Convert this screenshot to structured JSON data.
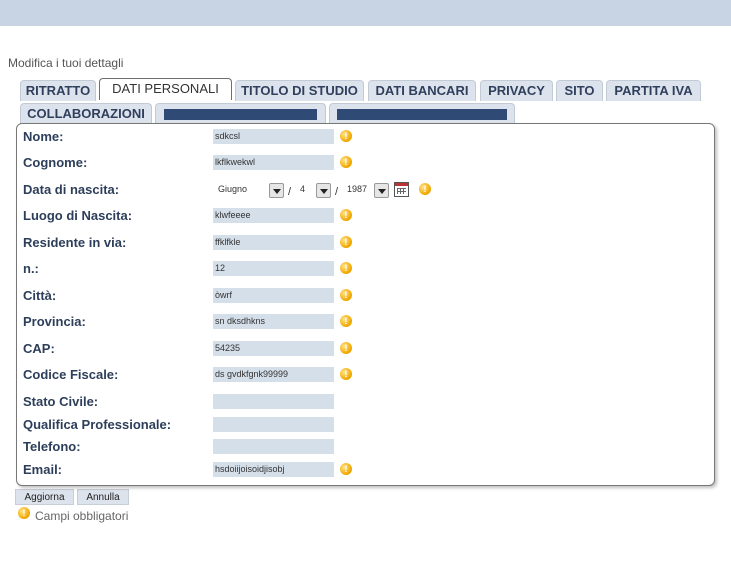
{
  "page_heading": "Modifica i tuoi dettagli",
  "tabs": {
    "ritratto": "RITRATTO",
    "dati_personali": "DATI PERSONALI",
    "titolo_di_studio": "TITOLO DI STUDIO",
    "dati_bancari": "DATI BANCARI",
    "privacy": "PRIVACY",
    "sito": "SITO",
    "partita_iva": "PARTITA IVA",
    "collaborazioni": "COLLABORAZIONI"
  },
  "form": {
    "nome": {
      "label": "Nome:",
      "value": "sdkcsl"
    },
    "cognome": {
      "label": "Cognome:",
      "value": "lkflkwekwl"
    },
    "data_nascita": {
      "label": "Data di nascita:",
      "month": "Giugno",
      "day": "4",
      "year": "1987",
      "separator": "/"
    },
    "luogo_nascita": {
      "label": "Luogo di Nascita:",
      "value": "klwfeeee"
    },
    "residente": {
      "label": "Residente in via:",
      "value": "ffklfkle"
    },
    "numero": {
      "label": "n.:",
      "value": "12"
    },
    "citta": {
      "label": "Città:",
      "value": "òwrf"
    },
    "provincia": {
      "label": "Provincia:",
      "value": "sn dksdhkns"
    },
    "cap": {
      "label": "CAP:",
      "value": "54235"
    },
    "codice_fiscale": {
      "label": "Codice Fiscale:",
      "value": "ds gvdkfgnk99999"
    },
    "stato_civile": {
      "label": "Stato Civile:",
      "value": ""
    },
    "qualifica": {
      "label": "Qualifica Professionale:",
      "value": ""
    },
    "telefono": {
      "label": "Telefono:",
      "value": ""
    },
    "email": {
      "label": "Email:",
      "value": "hsdoiijoisoidjisobj"
    }
  },
  "required_icon": "!",
  "buttons": {
    "aggiorna": "Aggiorna",
    "annulla": "Annulla"
  },
  "legend": {
    "required_text": "Campi obbligatori"
  },
  "colors": {
    "accent": "#2d3e5a",
    "tab_bg": "#dde3ec",
    "field_bg": "#d5dfea",
    "required_icon": "#f2a900",
    "topbar": "#c8d3e3"
  }
}
